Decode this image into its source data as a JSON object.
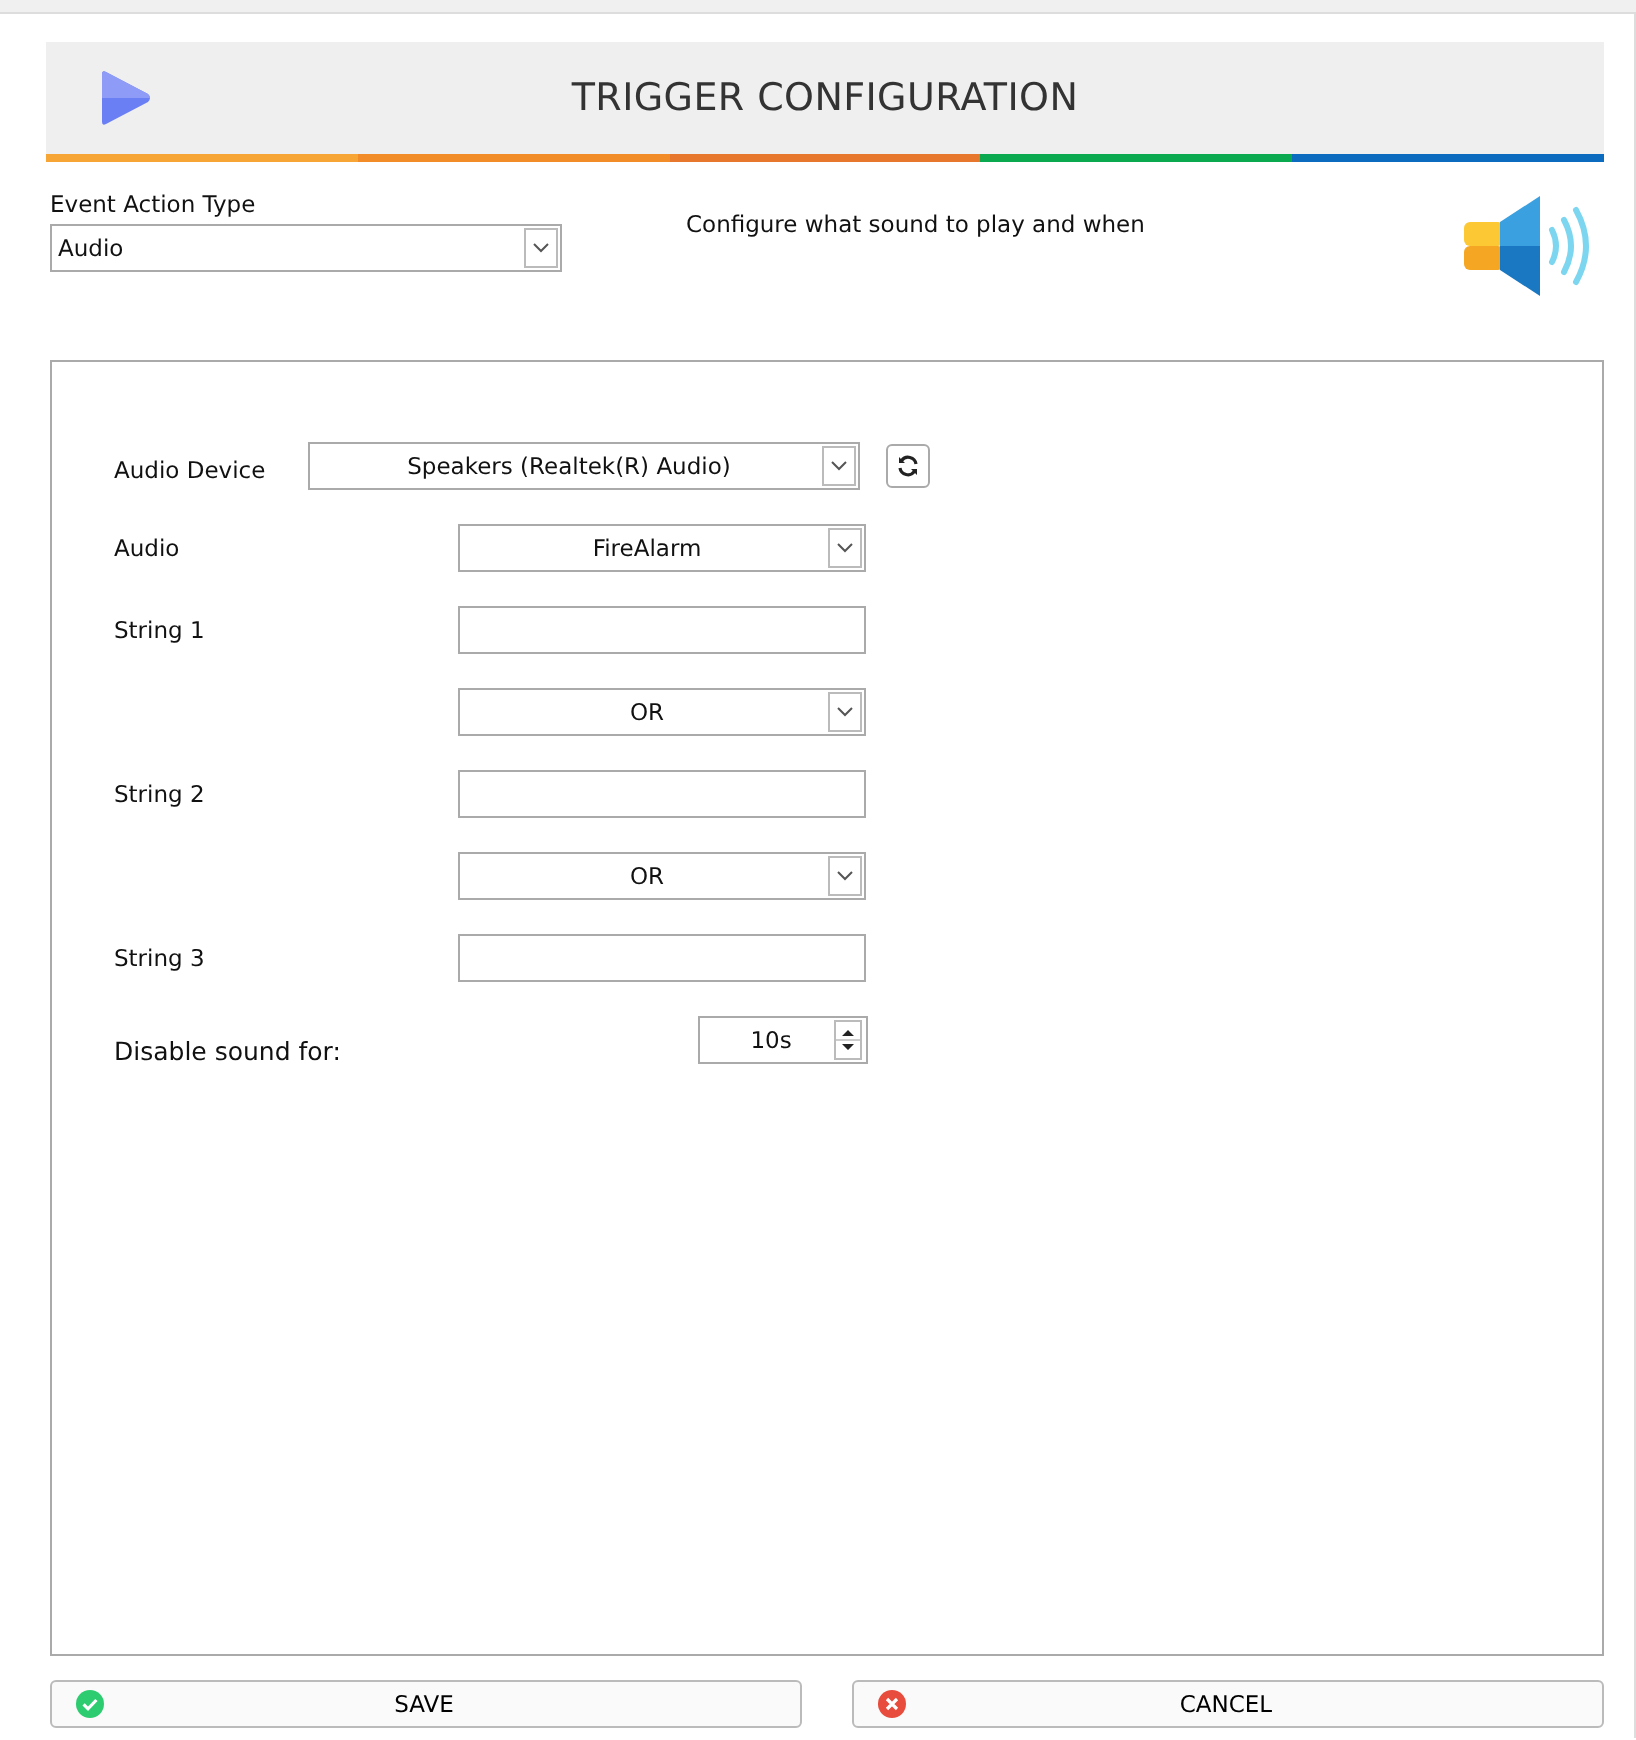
{
  "header": {
    "title": "TRIGGER CONFIGURATION"
  },
  "event_action_type": {
    "label": "Event Action Type",
    "value": "Audio"
  },
  "description": "Configure what sound to play and when",
  "form": {
    "rows": [
      {
        "kind": "device",
        "label": "Audio Device",
        "value": "Speakers (Realtek(R) Audio)"
      },
      {
        "kind": "select",
        "label": "Audio",
        "value": "FireAlarm"
      },
      {
        "kind": "text",
        "label": "String 1"
      },
      {
        "kind": "select",
        "value": "OR"
      },
      {
        "kind": "text",
        "label": "String 2"
      },
      {
        "kind": "select",
        "value": "OR"
      },
      {
        "kind": "text",
        "label": "String 3"
      },
      {
        "kind": "spin",
        "label": "Disable sound for:",
        "value": "10s"
      }
    ]
  },
  "buttons": [
    {
      "kind": "save",
      "label": "SAVE"
    },
    {
      "kind": "cancel",
      "label": "CANCEL"
    }
  ]
}
